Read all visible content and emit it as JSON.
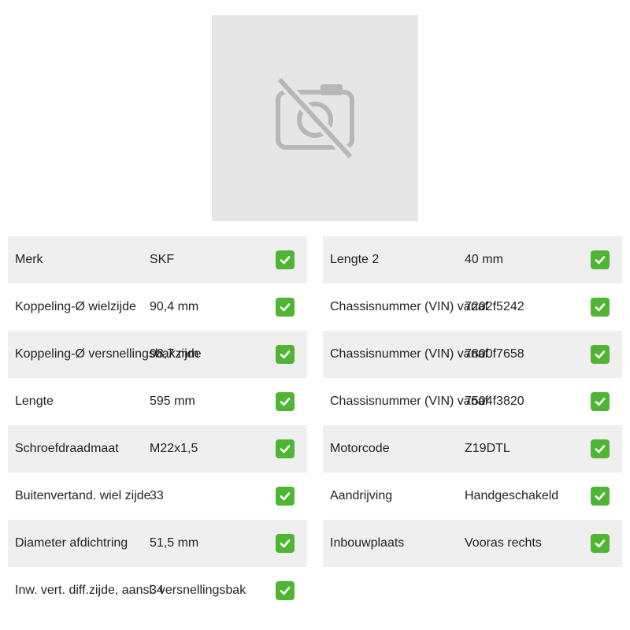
{
  "image": {
    "icon": "no-camera-icon"
  },
  "colors": {
    "row_shade": "#efefef",
    "check_green": "#4fb533",
    "placeholder_bg": "#e6e6e6",
    "placeholder_icon": "#b7b7b7"
  },
  "left_specs": [
    {
      "label": "Merk",
      "value": "SKF"
    },
    {
      "label": "Koppeling-Ø wielzijde",
      "value": "90,4 mm"
    },
    {
      "label": "Koppeling-Ø versnellingsbakzijde",
      "value": "98,7 mm"
    },
    {
      "label": "Lengte",
      "value": "595 mm"
    },
    {
      "label": "Schroefdraadmaat",
      "value": "M22x1,5"
    },
    {
      "label": "Buitenvertand. wiel zijde",
      "value": "33"
    },
    {
      "label": "Diameter afdichtring",
      "value": "51,5 mm"
    },
    {
      "label": "Inw. vert. diff.zijde, aansl. versnellingsbak",
      "value": "34"
    }
  ],
  "right_specs": [
    {
      "label": "Lengte 2",
      "value": "40 mm"
    },
    {
      "label": "Chassisnummer (VIN) vanaf",
      "value": "7202f5242"
    },
    {
      "label": "Chassisnummer (VIN) vanaf",
      "value": "7800f7658"
    },
    {
      "label": "Chassisnummer (VIN) vanaf",
      "value": "7504f3820"
    },
    {
      "label": "Motorcode",
      "value": "Z19DTL"
    },
    {
      "label": "Aandrijving",
      "value": "Handgeschakeld"
    },
    {
      "label": "Inbouwplaats",
      "value": "Vooras rechts"
    }
  ]
}
